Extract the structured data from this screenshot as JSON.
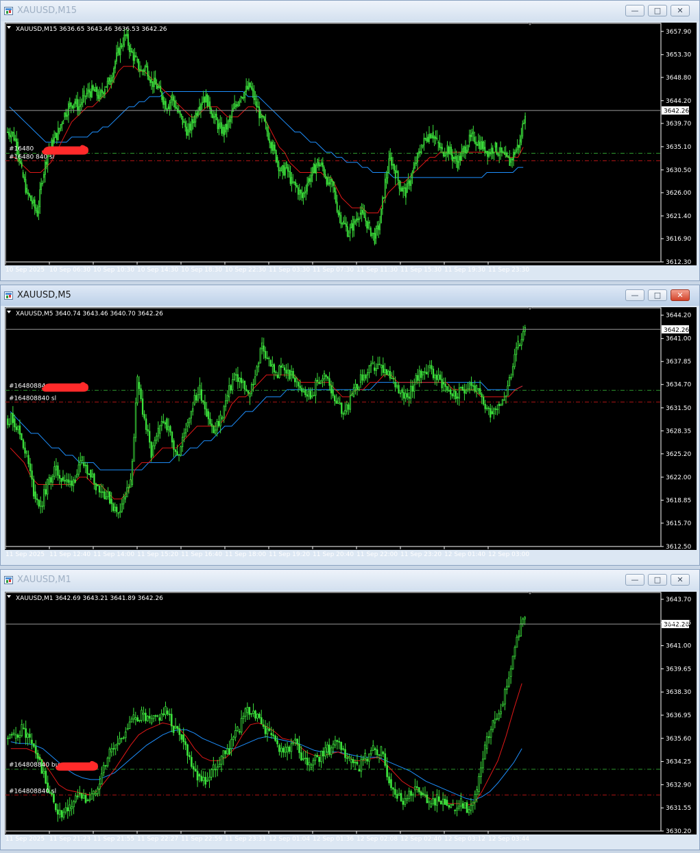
{
  "windows": [
    {
      "title": "XAUUSD,M15",
      "active": false,
      "header": "XAUUSD,M15  3636.65 3643.46 3636.53 3642.26",
      "price_box": "3642.26",
      "order_labels": [
        "#16480",
        "#16480 840 sl"
      ],
      "chart_data": {
        "type": "candlestick",
        "symbol": "XAUUSD",
        "timeframe": "M15",
        "ylim": [
          3612.3,
          3659.5
        ],
        "y_ticks": [
          "3657.90",
          "3653.30",
          "3648.80",
          "3644.20",
          "3639.70",
          "3635.10",
          "3630.50",
          "3626.00",
          "3621.40",
          "3616.90",
          "3612.30"
        ],
        "x_labels": [
          "10 Sep 2025",
          "10 Sep 06:30",
          "10 Sep 10:30",
          "10 Sep 14:30",
          "10 Sep 18:30",
          "10 Sep 22:30",
          "11 Sep 03:30",
          "11 Sep 07:30",
          "11 Sep 11:30",
          "11 Sep 15:30",
          "11 Sep 19:30",
          "11 Sep 23:30"
        ],
        "current_price": 3642.26,
        "levels": [
          {
            "name": "buy",
            "value": 3633.8,
            "color": "#2e9a2e",
            "style": "dash-dot"
          },
          {
            "name": "sl",
            "value": 3632.3,
            "color": "#b01414",
            "style": "dash-dot"
          }
        ],
        "closes": [
          3638.0,
          3636.0,
          3630.0,
          3626.0,
          3624.0,
          3622.0,
          3629.0,
          3634.0,
          3636.0,
          3638.0,
          3641.0,
          3643.0,
          3644.0,
          3643.0,
          3645.0,
          3646.0,
          3646.0,
          3645.0,
          3647.0,
          3648.0,
          3652.0,
          3655.0,
          3657.0,
          3654.0,
          3652.0,
          3650.0,
          3651.0,
          3648.0,
          3647.0,
          3645.0,
          3643.0,
          3645.0,
          3642.0,
          3640.0,
          3638.0,
          3640.0,
          3643.0,
          3645.0,
          3644.0,
          3641.0,
          3639.0,
          3638.0,
          3640.0,
          3643.0,
          3645.0,
          3646.0,
          3647.0,
          3644.0,
          3641.0,
          3639.0,
          3636.0,
          3633.0,
          3630.0,
          3631.0,
          3628.0,
          3627.0,
          3625.0,
          3628.0,
          3630.0,
          3632.0,
          3631.0,
          3628.0,
          3627.0,
          3622.0,
          3620.0,
          3618.0,
          3620.0,
          3622.0,
          3621.0,
          3619.0,
          3617.0,
          3620.0,
          3628.0,
          3633.0,
          3630.0,
          3627.0,
          3626.0,
          3629.0,
          3632.0,
          3635.0,
          3637.0,
          3638.0,
          3636.0,
          3634.0,
          3635.0,
          3633.0,
          3632.0,
          3634.0,
          3636.0,
          3637.0,
          3636.0,
          3635.0,
          3634.0,
          3635.0,
          3634.0,
          3633.0,
          3632.0,
          3634.0,
          3636.0,
          3642.26
        ],
        "ma_red": [
          3633.0,
          3633.0,
          3632.0,
          3631.0,
          3630.0,
          3630.0,
          3630.0,
          3631.0,
          3632.0,
          3634.0,
          3636.0,
          3638.0,
          3640.0,
          3641.0,
          3642.0,
          3643.0,
          3643.0,
          3644.0,
          3645.0,
          3646.0,
          3648.0,
          3650.0,
          3651.0,
          3651.0,
          3651.0,
          3650.0,
          3650.0,
          3649.0,
          3648.0,
          3647.0,
          3646.0,
          3645.0,
          3644.0,
          3643.0,
          3642.0,
          3641.0,
          3641.0,
          3642.0,
          3643.0,
          3643.0,
          3643.0,
          3642.0,
          3641.0,
          3641.0,
          3641.0,
          3642.0,
          3643.0,
          3643.0,
          3642.0,
          3641.0,
          3639.0,
          3637.0,
          3635.0,
          3634.0,
          3632.0,
          3631.0,
          3630.0,
          3630.0,
          3630.0,
          3630.0,
          3630.0,
          3629.0,
          3629.0,
          3627.0,
          3625.0,
          3624.0,
          3623.0,
          3623.0,
          3623.0,
          3622.0,
          3622.0,
          3622.0,
          3624.0,
          3626.0,
          3627.0,
          3628.0,
          3628.0,
          3629.0,
          3630.0,
          3631.0,
          3632.0,
          3633.0,
          3633.0,
          3634.0,
          3634.0,
          3634.0,
          3634.0,
          3634.0,
          3634.0,
          3634.0,
          3634.0,
          3634.0,
          3634.0,
          3634.0,
          3634.0,
          3634.0,
          3633.0,
          3633.0,
          3633.0,
          3635.0
        ],
        "ma_blue": [
          3643.0,
          3642.0,
          3641.0,
          3640.0,
          3639.0,
          3638.0,
          3637.0,
          3636.0,
          3636.0,
          3636.0,
          3636.0,
          3636.0,
          3637.0,
          3637.0,
          3637.0,
          3637.0,
          3638.0,
          3638.0,
          3639.0,
          3639.0,
          3640.0,
          3641.0,
          3642.0,
          3643.0,
          3643.0,
          3644.0,
          3644.0,
          3645.0,
          3645.0,
          3645.0,
          3646.0,
          3646.0,
          3646.0,
          3646.0,
          3646.0,
          3646.0,
          3646.0,
          3646.0,
          3646.0,
          3646.0,
          3646.0,
          3646.0,
          3646.0,
          3646.0,
          3646.0,
          3646.0,
          3645.0,
          3645.0,
          3645.0,
          3644.0,
          3643.0,
          3642.0,
          3641.0,
          3640.0,
          3639.0,
          3638.0,
          3638.0,
          3637.0,
          3636.0,
          3636.0,
          3635.0,
          3634.0,
          3634.0,
          3633.0,
          3633.0,
          3632.0,
          3632.0,
          3632.0,
          3631.0,
          3631.0,
          3630.0,
          3630.0,
          3630.0,
          3630.0,
          3629.0,
          3629.0,
          3629.0,
          3629.0,
          3629.0,
          3629.0,
          3629.0,
          3629.0,
          3629.0,
          3629.0,
          3629.0,
          3629.0,
          3629.0,
          3629.0,
          3629.0,
          3629.0,
          3629.0,
          3629.0,
          3630.0,
          3630.0,
          3630.0,
          3630.0,
          3630.0,
          3630.0,
          3631.0,
          3631.0
        ]
      }
    },
    {
      "title": "XAUUSD,M5",
      "active": true,
      "header": "XAUUSD,M5  3640.74 3643.46 3640.70 3642.26",
      "price_box": "3642.26",
      "order_labels": [
        "#16480884",
        "#164808840 sl"
      ],
      "chart_data": {
        "type": "candlestick",
        "symbol": "XAUUSD",
        "timeframe": "M5",
        "ylim": [
          3612.5,
          3645.2
        ],
        "y_ticks": [
          "3644.20",
          "3641.00",
          "3637.85",
          "3634.70",
          "3631.50",
          "3628.35",
          "3625.20",
          "3622.00",
          "3618.85",
          "3615.70",
          "3612.50"
        ],
        "x_labels": [
          "11 Sep 2025",
          "11 Sep 12:40",
          "11 Sep 14:00",
          "11 Sep 15:20",
          "11 Sep 16:40",
          "11 Sep 18:00",
          "11 Sep 19:20",
          "11 Sep 20:40",
          "11 Sep 22:00",
          "11 Sep 23:20",
          "12 Sep 01:40",
          "12 Sep 03:00"
        ],
        "current_price": 3642.26,
        "levels": [
          {
            "name": "buy",
            "value": 3633.9,
            "color": "#2e9a2e",
            "style": "dash-dot"
          },
          {
            "name": "sl",
            "value": 3632.3,
            "color": "#b01414",
            "style": "dash-dot"
          }
        ],
        "closes": [
          3630.0,
          3628.0,
          3625.0,
          3620.0,
          3618.0,
          3621.0,
          3623.0,
          3622.0,
          3621.0,
          3622.0,
          3624.0,
          3623.0,
          3621.0,
          3620.0,
          3619.0,
          3617.0,
          3619.0,
          3621.0,
          3635.0,
          3630.0,
          3625.0,
          3628.0,
          3630.0,
          3627.0,
          3625.0,
          3629.0,
          3632.0,
          3634.0,
          3631.0,
          3628.0,
          3630.0,
          3633.0,
          3636.0,
          3635.0,
          3633.0,
          3636.0,
          3640.0,
          3638.0,
          3636.0,
          3637.0,
          3636.0,
          3635.0,
          3634.0,
          3633.0,
          3635.0,
          3636.0,
          3634.0,
          3632.0,
          3631.0,
          3633.0,
          3635.0,
          3636.0,
          3637.0,
          3637.0,
          3636.0,
          3635.0,
          3634.0,
          3633.0,
          3635.0,
          3636.0,
          3637.0,
          3636.0,
          3635.0,
          3634.0,
          3633.0,
          3634.0,
          3635.0,
          3634.0,
          3632.0,
          3631.0,
          3632.0,
          3633.0,
          3636.0,
          3640.0,
          3642.26
        ],
        "ma_red": [
          3626.0,
          3625.0,
          3624.0,
          3622.0,
          3621.0,
          3621.0,
          3621.0,
          3621.0,
          3621.0,
          3621.0,
          3622.0,
          3622.0,
          3621.0,
          3621.0,
          3620.0,
          3619.0,
          3619.0,
          3620.0,
          3623.0,
          3624.0,
          3624.0,
          3625.0,
          3626.0,
          3626.0,
          3626.0,
          3627.0,
          3628.0,
          3629.0,
          3629.0,
          3629.0,
          3629.0,
          3630.0,
          3632.0,
          3633.0,
          3633.0,
          3634.0,
          3635.0,
          3636.0,
          3636.0,
          3636.0,
          3636.0,
          3636.0,
          3635.0,
          3635.0,
          3635.0,
          3635.0,
          3635.0,
          3634.0,
          3633.0,
          3633.0,
          3634.0,
          3634.0,
          3635.0,
          3635.0,
          3636.0,
          3636.0,
          3635.0,
          3635.0,
          3635.0,
          3635.0,
          3635.0,
          3635.0,
          3635.0,
          3635.0,
          3634.0,
          3634.0,
          3634.0,
          3634.0,
          3633.0,
          3633.0,
          3633.0,
          3633.0,
          3633.0,
          3634.0,
          3634.5
        ],
        "ma_blue": [
          3631.0,
          3630.0,
          3629.0,
          3628.0,
          3628.0,
          3627.0,
          3626.0,
          3626.0,
          3625.0,
          3625.0,
          3624.0,
          3624.0,
          3624.0,
          3623.0,
          3623.0,
          3623.0,
          3623.0,
          3623.0,
          3623.0,
          3623.0,
          3624.0,
          3624.0,
          3624.0,
          3624.0,
          3625.0,
          3625.0,
          3626.0,
          3626.0,
          3627.0,
          3627.0,
          3628.0,
          3629.0,
          3629.0,
          3630.0,
          3631.0,
          3631.0,
          3632.0,
          3633.0,
          3633.0,
          3633.0,
          3634.0,
          3634.0,
          3634.0,
          3634.0,
          3634.0,
          3634.0,
          3634.0,
          3634.0,
          3634.0,
          3634.0,
          3634.0,
          3634.0,
          3634.0,
          3635.0,
          3635.0,
          3635.0,
          3635.0,
          3635.0,
          3635.0,
          3635.0,
          3635.0,
          3635.0,
          3635.0,
          3635.0,
          3635.0,
          3635.0,
          3635.0,
          3635.0,
          3635.0,
          3634.0,
          3634.0,
          3634.0,
          3634.0,
          3634.0,
          3634.5
        ]
      }
    },
    {
      "title": "XAUUSD,M1",
      "active": false,
      "header": "XAUUSD,M1  3642.69 3643.21 3641.89 3642.26",
      "price_box": "3642.26",
      "order_labels": [
        "#164808840 buy",
        "#164808840 sl"
      ],
      "chart_data": {
        "type": "candlestick",
        "symbol": "XAUUSD",
        "timeframe": "M1",
        "ylim": [
          3630.2,
          3644.1
        ],
        "y_ticks": [
          "3643.70",
          "3642.35",
          "3641.00",
          "3639.65",
          "3638.30",
          "3636.95",
          "3635.60",
          "3634.25",
          "3632.90",
          "3631.55",
          "3630.20"
        ],
        "x_labels": [
          "11 Sep 2025",
          "11 Sep 21:23",
          "11 Sep 21:55",
          "11 Sep 22:27",
          "11 Sep 22:59",
          "11 Sep 23:31",
          "12 Sep 01:04",
          "12 Sep 01:36",
          "12 Sep 02:08",
          "12 Sep 02:40",
          "12 Sep 03:12",
          "12 Sep 03:44"
        ],
        "current_price": 3642.26,
        "levels": [
          {
            "name": "buy",
            "value": 3633.8,
            "color": "#2e9a2e",
            "style": "dash-dot"
          },
          {
            "name": "sl",
            "value": 3632.3,
            "color": "#b01414",
            "style": "dash-dot"
          }
        ],
        "closes": [
          3635.6,
          3636.2,
          3635.5,
          3634.5,
          3633.0,
          3631.8,
          3631.0,
          3631.5,
          3632.4,
          3632.0,
          3632.3,
          3633.6,
          3634.8,
          3635.3,
          3636.1,
          3636.7,
          3637.0,
          3636.5,
          3636.8,
          3637.2,
          3636.2,
          3635.8,
          3634.5,
          3633.5,
          3633.1,
          3633.8,
          3634.5,
          3635.0,
          3636.0,
          3637.1,
          3637.2,
          3636.4,
          3635.9,
          3635.2,
          3634.8,
          3635.5,
          3634.4,
          3633.9,
          3634.5,
          3634.8,
          3635.2,
          3635.0,
          3634.2,
          3633.8,
          3634.4,
          3635.0,
          3634.8,
          3633.2,
          3632.3,
          3632.0,
          3632.6,
          3632.4,
          3631.6,
          3632.2,
          3632.0,
          3631.4,
          3631.8,
          3631.4,
          3632.5,
          3635.0,
          3636.5,
          3637.5,
          3639.2,
          3641.5,
          3643.0
        ],
        "ma_red": [
          3635.0,
          3635.0,
          3635.0,
          3634.8,
          3634.3,
          3633.6,
          3632.9,
          3632.6,
          3632.5,
          3632.4,
          3632.3,
          3632.6,
          3633.2,
          3633.8,
          3634.5,
          3635.2,
          3635.8,
          3636.1,
          3636.3,
          3636.5,
          3636.4,
          3636.2,
          3635.7,
          3635.0,
          3634.5,
          3634.3,
          3634.3,
          3634.5,
          3635.0,
          3635.8,
          3636.4,
          3636.5,
          3636.3,
          3636.0,
          3635.6,
          3635.5,
          3635.2,
          3634.8,
          3634.6,
          3634.6,
          3634.7,
          3634.8,
          3634.6,
          3634.3,
          3634.3,
          3634.4,
          3634.5,
          3634.1,
          3633.6,
          3633.1,
          3632.8,
          3632.6,
          3632.2,
          3632.0,
          3631.9,
          3631.8,
          3631.8,
          3631.7,
          3631.8,
          3632.5,
          3633.4,
          3634.3,
          3635.7,
          3637.3,
          3638.8
        ],
        "ma_blue": [
          3635.4,
          3635.3,
          3635.3,
          3635.2,
          3635.0,
          3634.6,
          3634.2,
          3633.8,
          3633.5,
          3633.3,
          3633.2,
          3633.2,
          3633.4,
          3633.6,
          3634.0,
          3634.4,
          3634.8,
          3635.2,
          3635.5,
          3635.8,
          3636.0,
          3636.1,
          3636.1,
          3635.9,
          3635.6,
          3635.4,
          3635.2,
          3635.0,
          3635.0,
          3635.2,
          3635.4,
          3635.6,
          3635.7,
          3635.6,
          3635.5,
          3635.4,
          3635.3,
          3635.1,
          3634.9,
          3634.8,
          3634.8,
          3634.8,
          3634.7,
          3634.6,
          3634.5,
          3634.5,
          3634.5,
          3634.3,
          3634.1,
          3633.9,
          3633.7,
          3633.4,
          3633.1,
          3632.9,
          3632.7,
          3632.5,
          3632.3,
          3632.1,
          3632.0,
          3632.2,
          3632.5,
          3633.0,
          3633.6,
          3634.2,
          3635.0
        ]
      }
    }
  ]
}
